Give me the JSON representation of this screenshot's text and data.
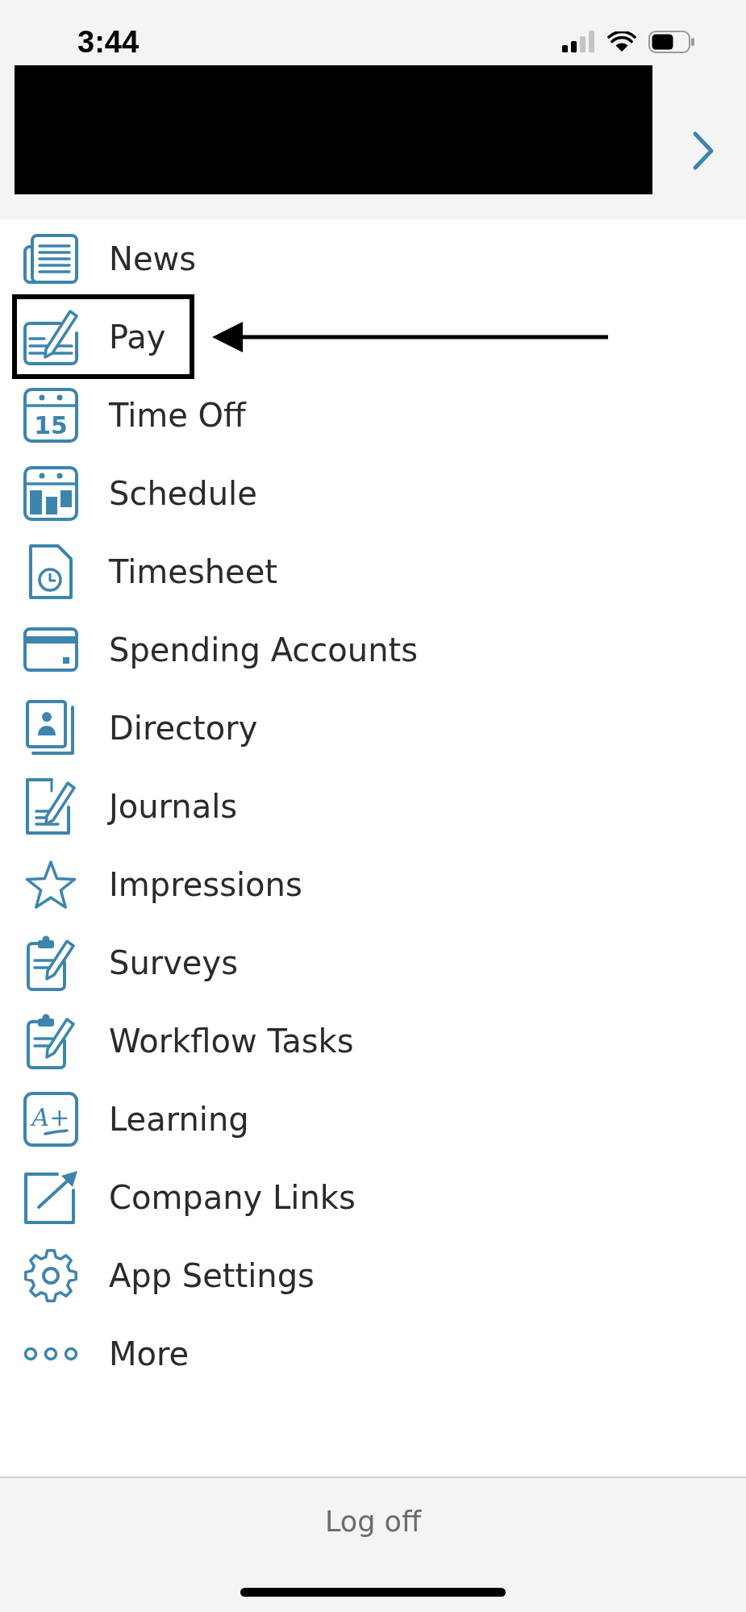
{
  "status_bar": {
    "time": "3:44"
  },
  "menu": {
    "items": [
      {
        "kind": "news",
        "label": "News",
        "highlighted": false
      },
      {
        "kind": "pay",
        "label": "Pay",
        "highlighted": true
      },
      {
        "kind": "timeoff",
        "label": "Time Off",
        "icon_label": "15",
        "highlighted": false
      },
      {
        "kind": "schedule",
        "label": "Schedule",
        "highlighted": false
      },
      {
        "kind": "timesheet",
        "label": "Timesheet",
        "highlighted": false
      },
      {
        "kind": "spending",
        "label": "Spending Accounts",
        "highlighted": false
      },
      {
        "kind": "directory",
        "label": "Directory",
        "highlighted": false
      },
      {
        "kind": "journals",
        "label": "Journals",
        "highlighted": false
      },
      {
        "kind": "impressions",
        "label": "Impressions",
        "highlighted": false
      },
      {
        "kind": "surveys",
        "label": "Surveys",
        "highlighted": false
      },
      {
        "kind": "workflow",
        "label": "Workflow Tasks",
        "highlighted": false
      },
      {
        "kind": "learning",
        "label": "Learning",
        "icon_label": "A+",
        "highlighted": false
      },
      {
        "kind": "links",
        "label": "Company Links",
        "highlighted": false
      },
      {
        "kind": "settings",
        "label": "App Settings",
        "highlighted": false
      },
      {
        "kind": "more",
        "label": "More",
        "highlighted": false
      }
    ]
  },
  "footer": {
    "logoff_button": "Log off"
  }
}
